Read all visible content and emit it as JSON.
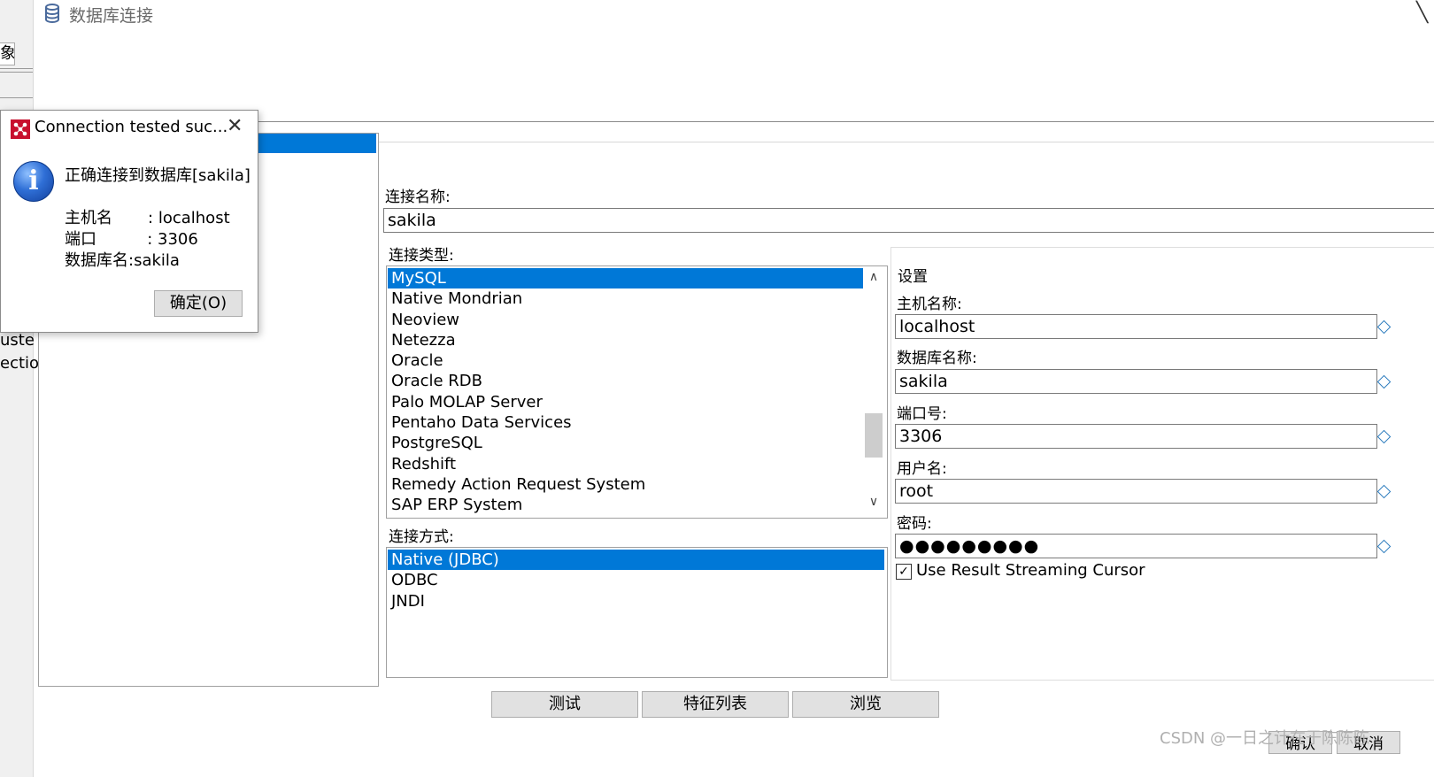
{
  "window": {
    "title": "数据库连接"
  },
  "background": {
    "tab_fragment": "象",
    "text1": "uste",
    "text2": "ectio"
  },
  "labels": {
    "connection_name": "连接名称:",
    "connection_type": "连接类型:",
    "access": "连接方式:",
    "settings": "设置",
    "host": "主机名称:",
    "database": "数据库名称:",
    "port": "端口号:",
    "username": "用户名:",
    "password": "密码:"
  },
  "connection_name_value": "sakila",
  "connection_types": [
    "MySQL",
    "Native Mondrian",
    "Neoview",
    "Netezza",
    "Oracle",
    "Oracle RDB",
    "Palo MOLAP Server",
    "Pentaho Data Services",
    "PostgreSQL",
    "Redshift",
    "Remedy Action Request System",
    "SAP ERP System"
  ],
  "selected_type": "MySQL",
  "access_methods": [
    "Native (JDBC)",
    "ODBC",
    "JNDI"
  ],
  "selected_access": "Native (JDBC)",
  "settings": {
    "host": "localhost",
    "database": "sakila",
    "port": "3306",
    "username": "root",
    "password_mask": "●●●●●●●●●",
    "streaming_cursor_label": "Use Result Streaming Cursor",
    "streaming_cursor_checked": true
  },
  "buttons": {
    "test": "测试",
    "features": "特征列表",
    "explore": "浏览",
    "ok": "确认",
    "cancel": "取消"
  },
  "watermark": "CSDN @一日之计在于陈陈陈",
  "dialog": {
    "title": "Connection tested suc...",
    "message": "正确连接到数据库[sakila]",
    "host_line": "主机名       : localhost",
    "port_line": "端口          : 3306",
    "db_line": "数据库名:sakila",
    "ok_button": "确定(O)"
  },
  "colors": {
    "selection": "#0078d7",
    "dialog_icon": "#c8102e",
    "info_icon": "#2f6fd6"
  }
}
